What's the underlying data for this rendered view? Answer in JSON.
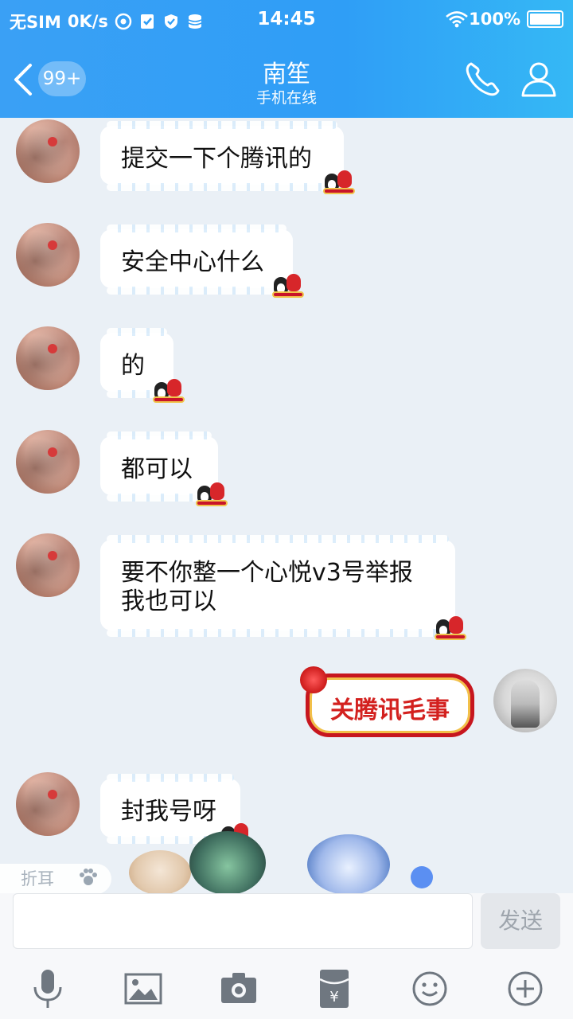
{
  "status_bar": {
    "carrier": "无SIM",
    "speed": "0K/s",
    "time": "14:45",
    "battery": "100%"
  },
  "header": {
    "back_badge": "99+",
    "title": "南笙",
    "subtitle": "手机在线",
    "icons": [
      "back-icon",
      "phone-icon",
      "person-icon"
    ]
  },
  "messages": [
    {
      "side": "left",
      "text": "提交一下个腾讯的"
    },
    {
      "side": "left",
      "text": "安全中心什么"
    },
    {
      "side": "left",
      "text": "的"
    },
    {
      "side": "left",
      "text": "都可以"
    },
    {
      "side": "left",
      "line1": "要不你整一个心悦v3号举报",
      "line2": "我也可以"
    },
    {
      "side": "right",
      "text": "关腾讯毛事"
    },
    {
      "side": "left",
      "text": "封我号呀"
    }
  ],
  "fold_tab": "折耳",
  "input_bar": {
    "placeholder": "",
    "send_label": "发送",
    "tools": [
      "mic-icon",
      "image-icon",
      "camera-icon",
      "red-packet-icon",
      "emoji-icon",
      "plus-icon"
    ]
  },
  "colors": {
    "header_blue": "#2f9ef6",
    "send_disabled": "#e4e7eb",
    "gift_red": "#c7161e"
  }
}
